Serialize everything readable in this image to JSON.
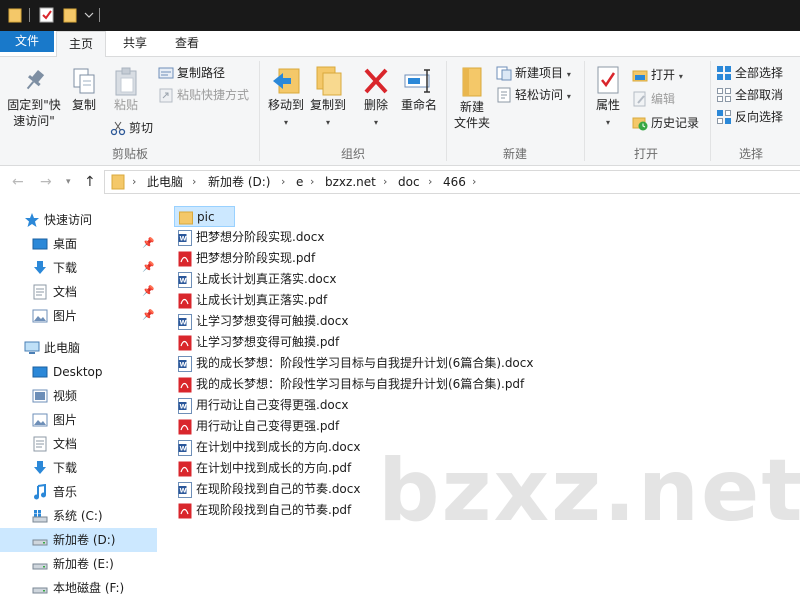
{
  "ribbon_tabs": [
    "文件",
    "主页",
    "共享",
    "查看"
  ],
  "ribbon": {
    "clipboard": {
      "group_label": "剪贴板",
      "pin_quick_access": "固定到\"快\n速访问\"",
      "copy": "复制",
      "paste": "粘贴",
      "copy_path": "复制路径",
      "paste_shortcut": "粘贴快捷方式",
      "cut": "剪切"
    },
    "organize": {
      "group_label": "组织",
      "move_to": "移动到",
      "copy_to": "复制到",
      "delete": "删除",
      "rename": "重命名"
    },
    "new": {
      "group_label": "新建",
      "new_folder": "新建\n文件夹",
      "new_item": "新建项目",
      "easy_access": "轻松访问"
    },
    "open": {
      "group_label": "打开",
      "properties": "属性",
      "open": "打开",
      "edit": "编辑",
      "history": "历史记录"
    },
    "select": {
      "group_label": "选择",
      "select_all": "全部选择",
      "select_none": "全部取消",
      "invert": "反向选择"
    }
  },
  "address": {
    "crumbs": [
      "此电脑",
      "新加卷 (D:)",
      "e",
      "bzxz.net",
      "doc",
      "466"
    ]
  },
  "sidebar": {
    "quick_access": "快速访问",
    "quick_items": [
      "桌面",
      "下载",
      "文档",
      "图片"
    ],
    "this_pc": "此电脑",
    "pc_items": [
      "Desktop",
      "视频",
      "图片",
      "文档",
      "下载",
      "音乐",
      "系统 (C:)",
      "新加卷 (D:)",
      "新加卷 (E:)",
      "本地磁盘 (F:)"
    ]
  },
  "files": [
    {
      "name": "pic",
      "type": "folder"
    },
    {
      "name": "把梦想分阶段实现.docx",
      "type": "docx"
    },
    {
      "name": "把梦想分阶段实现.pdf",
      "type": "pdf"
    },
    {
      "name": "让成长计划真正落实.docx",
      "type": "docx"
    },
    {
      "name": "让成长计划真正落实.pdf",
      "type": "pdf"
    },
    {
      "name": "让学习梦想变得可触摸.docx",
      "type": "docx"
    },
    {
      "name": "让学习梦想变得可触摸.pdf",
      "type": "pdf"
    },
    {
      "name": "我的成长梦想：阶段性学习目标与自我提升计划(6篇合集).docx",
      "type": "docx"
    },
    {
      "name": "我的成长梦想：阶段性学习目标与自我提升计划(6篇合集).pdf",
      "type": "pdf"
    },
    {
      "name": "用行动让自己变得更强.docx",
      "type": "docx"
    },
    {
      "name": "用行动让自己变得更强.pdf",
      "type": "pdf"
    },
    {
      "name": "在计划中找到成长的方向.docx",
      "type": "docx"
    },
    {
      "name": "在计划中找到成长的方向.pdf",
      "type": "pdf"
    },
    {
      "name": "在现阶段找到自己的节奏.docx",
      "type": "docx"
    },
    {
      "name": "在现阶段找到自己的节奏.pdf",
      "type": "pdf"
    }
  ],
  "watermark": "bzxz.net",
  "colors": {
    "accent": "#1979ca",
    "selection": "#cce8ff",
    "folder": "#f4c869",
    "pdf": "#d9262c",
    "word": "#2b579a"
  }
}
